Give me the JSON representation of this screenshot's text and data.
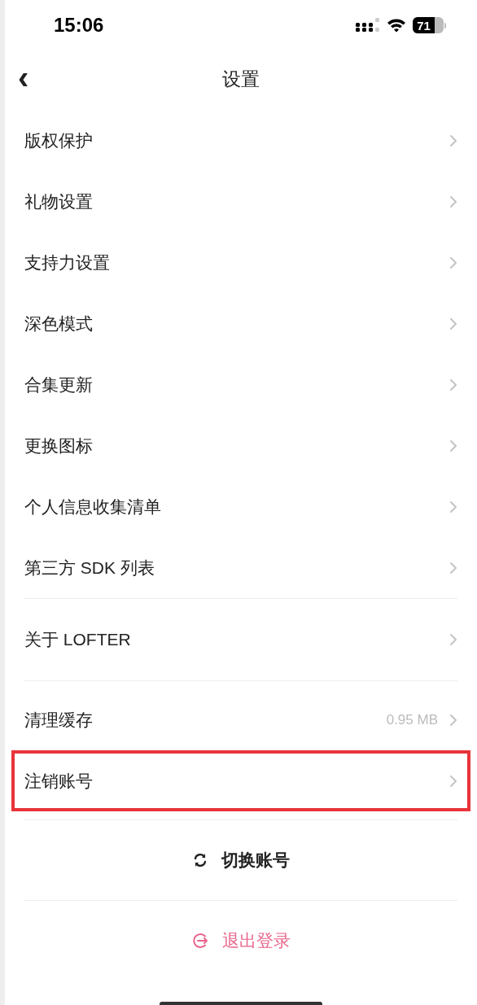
{
  "status_bar": {
    "time": "15:06",
    "battery": "71"
  },
  "nav": {
    "back": "‹",
    "title": "设置"
  },
  "groups": [
    {
      "items": [
        {
          "label": "版权保护",
          "highlighted": false
        },
        {
          "label": "礼物设置",
          "highlighted": false
        },
        {
          "label": "支持力设置",
          "highlighted": false
        },
        {
          "label": "深色模式",
          "highlighted": false
        },
        {
          "label": "合集更新",
          "highlighted": false
        },
        {
          "label": "更换图标",
          "highlighted": false
        },
        {
          "label": "个人信息收集清单",
          "highlighted": false
        },
        {
          "label": "第三方 SDK 列表",
          "highlighted": false
        }
      ]
    },
    {
      "items": [
        {
          "label": "关于 LOFTER",
          "highlighted": false
        }
      ]
    },
    {
      "items": [
        {
          "label": "清理缓存",
          "value": "0.95 MB",
          "highlighted": false
        },
        {
          "label": "注销账号",
          "highlighted": true
        }
      ]
    }
  ],
  "actions": [
    {
      "kind": "switch",
      "label": "切换账号"
    },
    {
      "kind": "logout",
      "label": "退出登录"
    }
  ]
}
